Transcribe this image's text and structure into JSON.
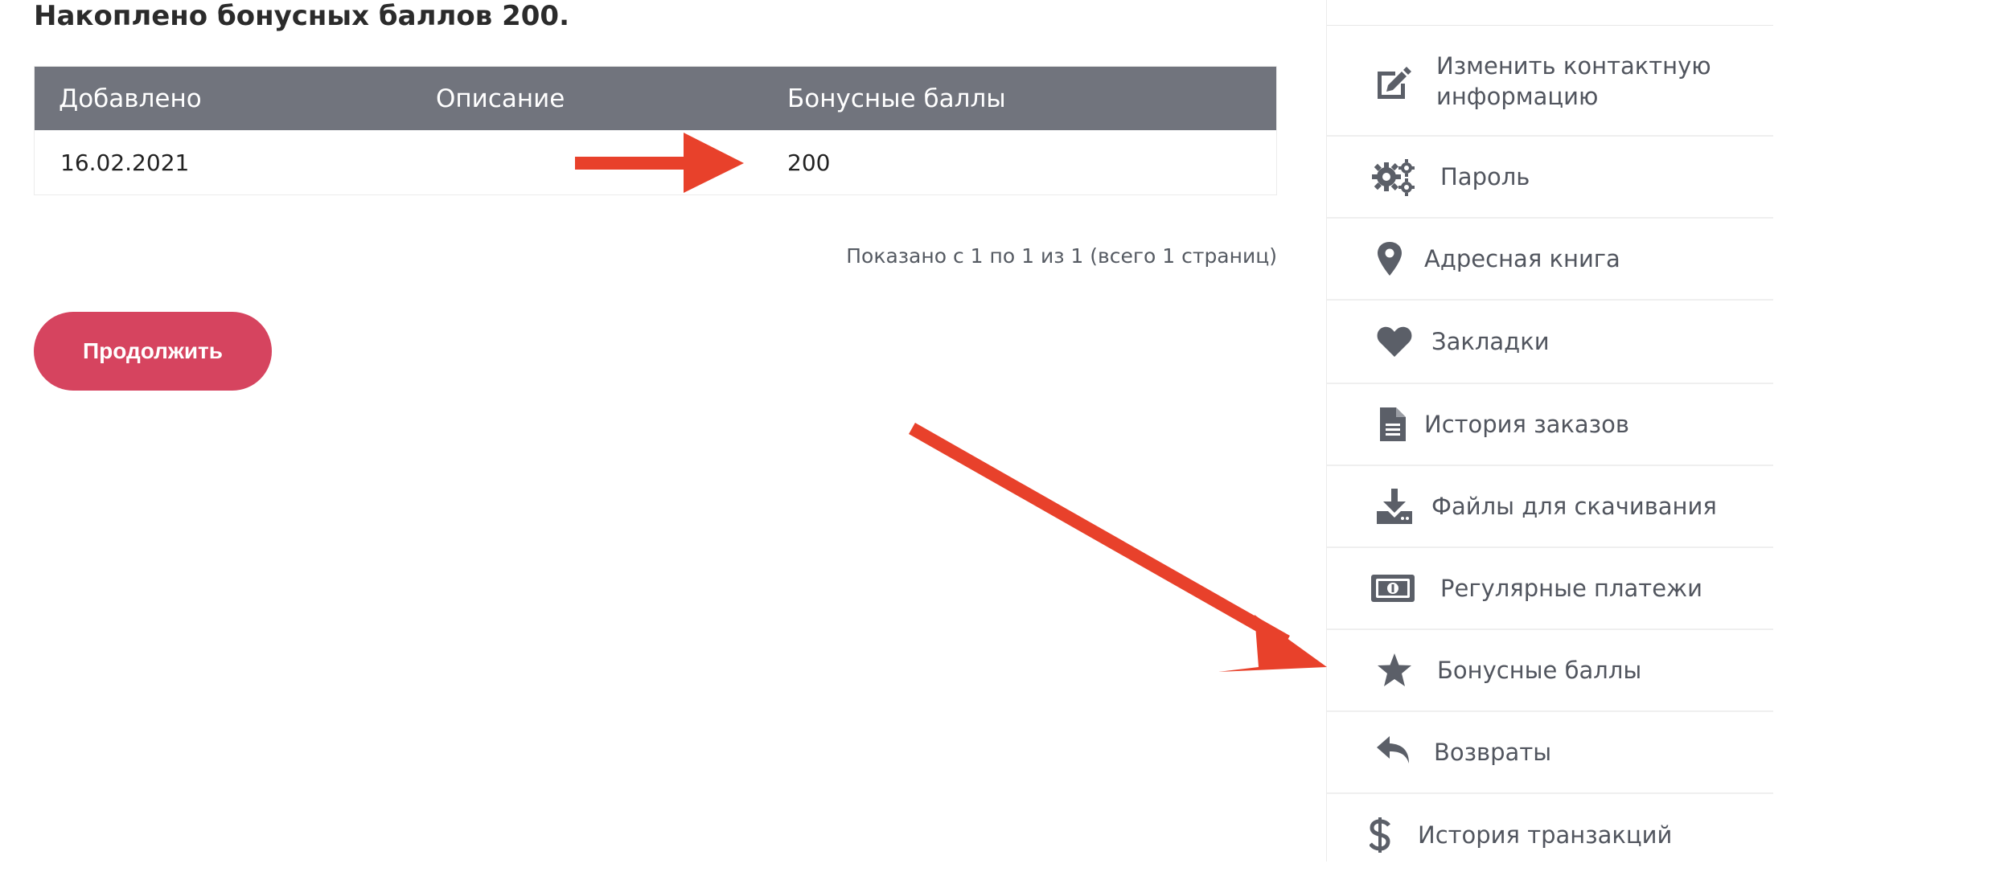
{
  "heading": {
    "prefix": "Накоплено бонусных баллов ",
    "amount": "200",
    "suffix": "."
  },
  "table": {
    "columns": [
      "Добавлено",
      "Описание",
      "Бонусные баллы"
    ],
    "rows": [
      {
        "date": "16.02.2021",
        "description": "",
        "points": "200"
      }
    ]
  },
  "pagination": "Показано с 1 по 1 из 1 (всего 1 страниц)",
  "continue_label": "Продолжить",
  "sidebar": {
    "items": [
      {
        "label": "Изменить контактную информацию",
        "icon": "edit-icon"
      },
      {
        "label": "Пароль",
        "icon": "gears-icon"
      },
      {
        "label": "Адресная книга",
        "icon": "map-marker-icon"
      },
      {
        "label": "Закладки",
        "icon": "heart-icon"
      },
      {
        "label": "История заказов",
        "icon": "document-icon"
      },
      {
        "label": "Файлы для скачивания",
        "icon": "download-icon"
      },
      {
        "label": "Регулярные платежи",
        "icon": "money-icon"
      },
      {
        "label": "Бонусные баллы",
        "icon": "star-icon"
      },
      {
        "label": "Возвраты",
        "icon": "reply-icon"
      },
      {
        "label": "История транзакций",
        "icon": "dollar-icon"
      }
    ]
  },
  "colors": {
    "table_header_bg": "#71747d",
    "button_bg": "#d6445f",
    "annotation_arrow": "#e8412b",
    "icon": "#5b5f68"
  }
}
